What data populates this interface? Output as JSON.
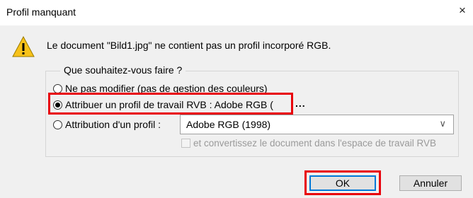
{
  "dialog": {
    "title": "Profil manquant",
    "close_symbol": "×"
  },
  "icons": {
    "warning": "warning-icon",
    "close": "close-icon",
    "dropdown": "chevron-down-icon"
  },
  "message": "Le document \"Bild1.jpg\" ne contient pas un profil incorporé RGB.",
  "group": {
    "legend": "Que souhaitez-vous faire ?",
    "options": [
      {
        "label": "Ne pas modifier (pas de gestion des couleurs)",
        "selected": false
      },
      {
        "label": "Attribuer un profil de travail RVB :  Adobe RGB (",
        "selected": true,
        "suffix": "..."
      },
      {
        "label": "Attribution d'un profil :",
        "selected": false
      }
    ],
    "profile_select_value": "Adobe RGB (1998)",
    "convert_checkbox_label": "et convertissez le document dans l'espace de travail RVB",
    "convert_checked": false
  },
  "buttons": {
    "ok": "OK",
    "cancel": "Annuler"
  },
  "colors": {
    "highlight": "#e8000b",
    "focus": "#0078d7",
    "warning_fill": "#f7c21a"
  }
}
